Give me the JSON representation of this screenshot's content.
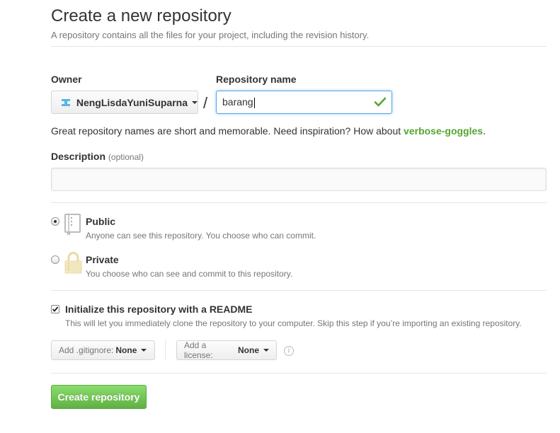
{
  "header": {
    "title": "Create a new repository",
    "subtitle": "A repository contains all the files for your project, including the revision history."
  },
  "owner": {
    "label": "Owner",
    "value": "NengLisdaYuniSuparna"
  },
  "separator": "/",
  "repo_name": {
    "label": "Repository name",
    "value": "barang",
    "valid": true
  },
  "hint": {
    "text": "Great repository names are short and memorable. Need inspiration? How about ",
    "suggestion": "verbose-goggles",
    "end": "."
  },
  "description": {
    "label": "Description",
    "optional": "(optional)",
    "value": ""
  },
  "visibility": {
    "selected": "public",
    "public": {
      "title": "Public",
      "note": "Anyone can see this repository. You choose who can commit."
    },
    "private": {
      "title": "Private",
      "note": "You choose who can see and commit to this repository."
    }
  },
  "init_readme": {
    "checked": true,
    "title": "Initialize this repository with a README",
    "note": "This will let you immediately clone the repository to your computer. Skip this step if you’re importing an existing repository."
  },
  "gitignore": {
    "label": "Add .gitignore:",
    "value": "None"
  },
  "license": {
    "label": "Add a license:",
    "value": "None"
  },
  "submit": {
    "label": "Create repository"
  },
  "icons": {
    "owner_avatar": "identicon-avatar",
    "repo_public": "book-repo-icon",
    "repo_private": "lock-icon",
    "valid": "checkmark-icon",
    "info": "info-icon"
  },
  "colors": {
    "accent_green": "#55a532",
    "button_green": "#60b044",
    "focus_blue": "#51a7e8",
    "lock_gold": "#e9dba5"
  }
}
